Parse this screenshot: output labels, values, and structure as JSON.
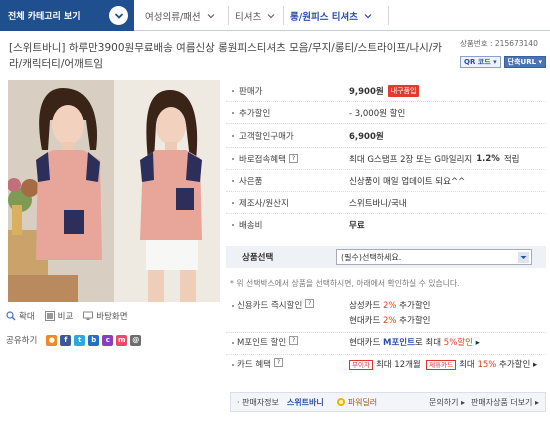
{
  "nav": {
    "category_button": "전체 카테고리 보기",
    "breadcrumb": [
      "여성의류/패션",
      "티셔츠",
      "롱/원피스 티셔츠"
    ]
  },
  "product": {
    "title": "[스위트바니] 하루만3900원무료배송 여름신상 롱원피스티셔츠 모음/무지/롱티/스트라이프/나시/카라/캐릭터티/어깨트임",
    "product_number": "상품번호 : 215673140",
    "qr_button": "QR 코드",
    "short_url_button": "단축URL"
  },
  "info": {
    "price_label": "판매가",
    "price_value": "9,900원",
    "tax_badge": "내구품입",
    "discount_label": "추가할인",
    "discount_value": "- 3,000원 할인",
    "sale_label": "고객할인구매가",
    "sale_value": "6,900원",
    "benefit_label": "바로접속혜택",
    "benefit_value_pre": "최대 G스탬프 2장 또는 G마일리지 ",
    "benefit_value_bold": "1.2%",
    "benefit_value_post": "적립",
    "gift_label": "사은품",
    "gift_value": "신상품이 매일 업데이트 되요^^",
    "maker_label": "제조사/원산지",
    "maker_value": "스위트바니/국내",
    "shipping_label": "배송비",
    "shipping_value": "무료"
  },
  "option": {
    "label": "상품선택",
    "placeholder": "(필수)선택하세요.",
    "notice": "* 위 선택박스에서 상품을 선택하시면, 아래에서 확인하실 수 있습니다."
  },
  "image_actions": {
    "zoom": "확대",
    "compare": "비교",
    "popup": "바탕화면",
    "share": "공유하기"
  },
  "cards": {
    "card_discount_label": "신용카드 즉시할인",
    "samsung_pre": "삼성카드 ",
    "samsung_pct": "2%",
    "samsung_post": " 추가할인",
    "hyundai_pre": "현대카드 ",
    "hyundai_pct": "2%",
    "hyundai_post": " 추가할인",
    "mpoint_label": "M포인트 할인",
    "mpoint_pre": "현대카드 ",
    "mpoint_blue": "M포인트",
    "mpoint_mid": "로 최대 ",
    "mpoint_pct": "5%할인",
    "card_benefit_label": "카드 혜택",
    "interest_free_tag": "무이자",
    "interest_free_value": "최대 12개월",
    "reward_tag": "제휴카드",
    "reward_pre": "최대 ",
    "reward_pct": "15%",
    "reward_post": " 추가할인"
  },
  "seller": {
    "label": "판매자정보",
    "name": "스위트바니",
    "grade": "파워딜러",
    "inquiry": "문의하기",
    "more": "판매자상품 더보기"
  },
  "colors": {
    "brand_blue": "#1f4f8f",
    "sale_red": "#e0401f",
    "link_blue": "#2b4fa8"
  }
}
